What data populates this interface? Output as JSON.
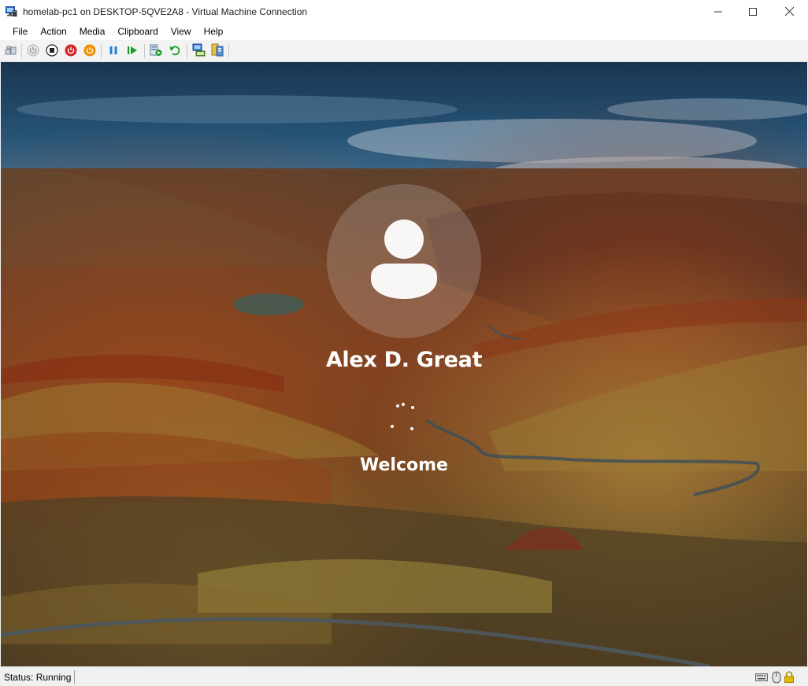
{
  "window": {
    "title": "homelab-pc1 on DESKTOP-5QVE2A8 - Virtual Machine Connection",
    "icon": "virtual-machine-icon",
    "controls": [
      "minimize-icon",
      "maximize-icon",
      "close-icon"
    ]
  },
  "menu": {
    "items": [
      {
        "label": "File"
      },
      {
        "label": "Action"
      },
      {
        "label": "Media"
      },
      {
        "label": "Clipboard"
      },
      {
        "label": "View"
      },
      {
        "label": "Help"
      }
    ]
  },
  "toolbar": {
    "buttons": [
      "ctrl-alt-del-icon",
      "start-icon",
      "turn-off-icon",
      "shut-down-icon",
      "save-state-icon",
      "pause-icon",
      "resume-icon",
      "checkpoint-icon",
      "revert-icon",
      "enhanced-session-icon",
      "share-icon"
    ]
  },
  "vm": {
    "user_name": "Alex D. Great",
    "status_message": "Welcome",
    "avatar_icon": "user-avatar-icon"
  },
  "statusbar": {
    "status": "Status: Running",
    "icons": [
      "keyboard-icon",
      "mouse-icon",
      "lock-icon"
    ]
  },
  "colors": {
    "pause": "#1e7fd6",
    "resume": "#1a9e2c",
    "turn_off": "#d32020",
    "shut_down": "#e07a00",
    "lock": "#e5b800"
  }
}
